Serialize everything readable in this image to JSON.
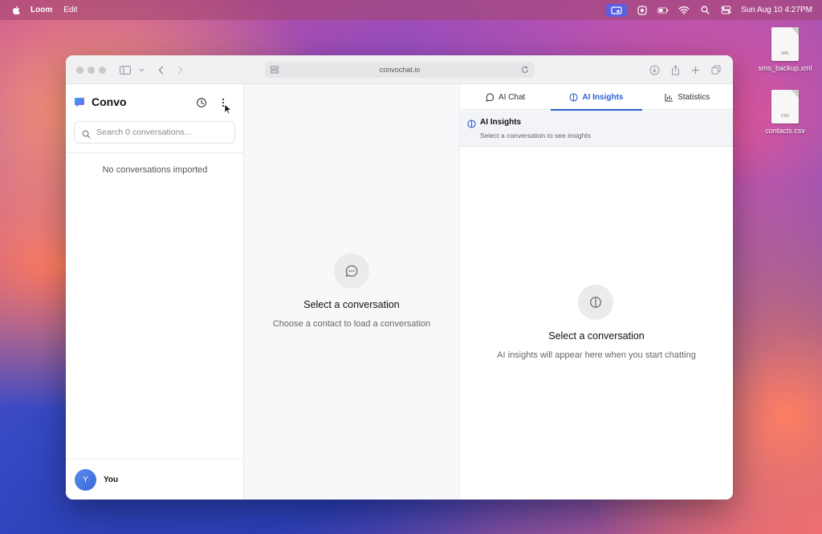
{
  "menubar": {
    "app_name": "Loom",
    "menu_edit": "Edit",
    "clock": "Sun Aug 10  4:27PM"
  },
  "desktop": {
    "files": [
      {
        "name": "sms_backup.xml",
        "ext": "XML"
      },
      {
        "name": "contacts.csv",
        "ext": "CSV"
      }
    ]
  },
  "browser": {
    "url": "convochat.io"
  },
  "sidebar": {
    "brand": "Convo",
    "search_placeholder": "Search 0 conversations...",
    "empty_text": "No conversations imported",
    "user": {
      "initial": "Y",
      "name": "You"
    }
  },
  "middle": {
    "title": "Select a conversation",
    "subtitle": "Choose a contact to load a conversation"
  },
  "right": {
    "tabs": [
      {
        "label": "AI Chat",
        "icon": "chat-bubble-icon"
      },
      {
        "label": "AI Insights",
        "icon": "insights-icon",
        "active": true
      },
      {
        "label": "Statistics",
        "icon": "bar-chart-icon"
      }
    ],
    "header_title": "AI Insights",
    "header_subtitle": "Select a conversation to see insights",
    "empty_title": "Select a conversation",
    "empty_subtitle": "AI insights will appear here when you start chatting"
  },
  "colors": {
    "accent": "#2c5fd6",
    "avatar": "#4a78e6"
  }
}
